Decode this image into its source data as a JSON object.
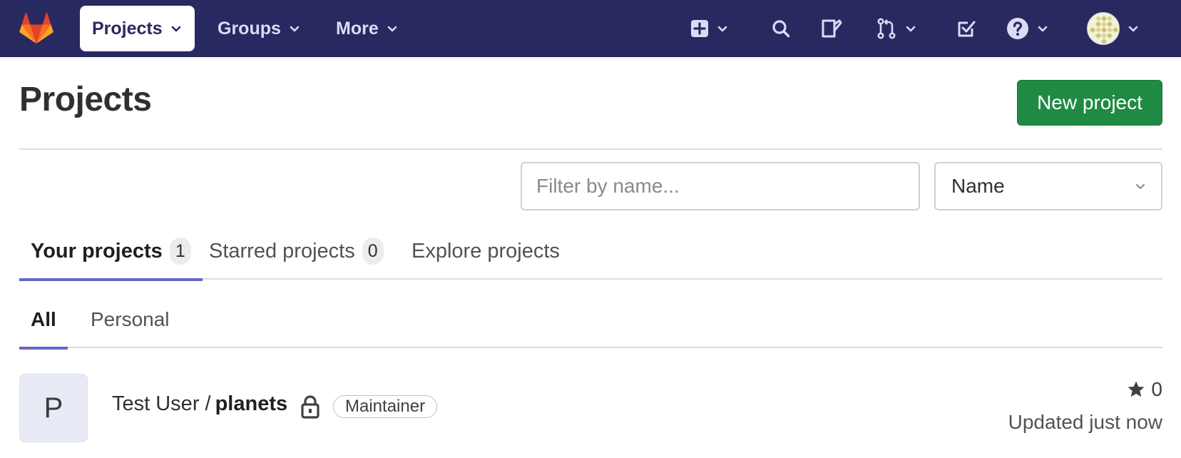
{
  "navbar": {
    "projects_label": "Projects",
    "groups_label": "Groups",
    "more_label": "More",
    "icons": [
      "plus-square-icon",
      "search-icon",
      "issues-icon",
      "merge-request-icon",
      "todo-icon",
      "help-icon"
    ]
  },
  "page": {
    "title": "Projects",
    "new_project_label": "New project"
  },
  "filter": {
    "placeholder": "Filter by name...",
    "sort_value": "Name"
  },
  "tabs": [
    {
      "label": "Your projects",
      "count": "1"
    },
    {
      "label": "Starred projects",
      "count": "0"
    },
    {
      "label": "Explore projects"
    }
  ],
  "subtabs": [
    {
      "label": "All"
    },
    {
      "label": "Personal"
    }
  ],
  "projects": [
    {
      "avatar_letter": "P",
      "namespace": "Test User /",
      "name": "planets",
      "role": "Maintainer",
      "stars": "0",
      "updated": "Updated just now"
    }
  ],
  "colors": {
    "navbar": "#292961",
    "primary_button": "#1f8a43",
    "tab_indicator": "#6666c4"
  }
}
